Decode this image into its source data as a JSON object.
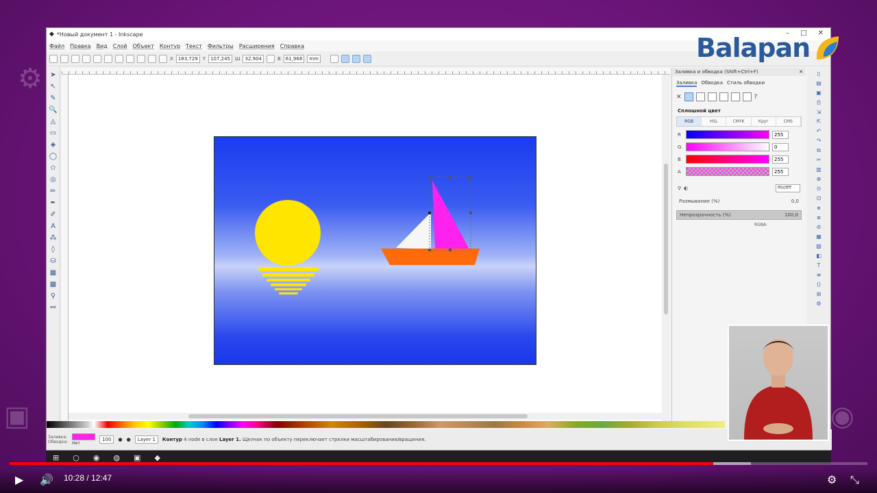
{
  "window": {
    "title": "*Новый документ 1 - Inkscape",
    "controls": [
      "–",
      "□",
      "✕"
    ]
  },
  "menu": [
    "Файл",
    "Правка",
    "Вид",
    "Слой",
    "Объект",
    "Контур",
    "Текст",
    "Фильтры",
    "Расширения",
    "Справка"
  ],
  "tool_controls": {
    "x_label": "X",
    "x_value": "183,729",
    "y_label": "Y",
    "y_value": "107,245",
    "w_label": "Ш",
    "w_value": "32,904",
    "h_label": "В",
    "h_value": "61,968",
    "unit": "mm"
  },
  "tools": [
    "pointer-icon",
    "node-icon",
    "tweak-icon",
    "zoom-icon",
    "measure-icon",
    "rect-icon",
    "3dbox-icon",
    "ellipse-icon",
    "star-icon",
    "spiral-icon",
    "pencil-icon",
    "pen-icon",
    "calligraphy-icon",
    "text-icon",
    "spray-icon",
    "eraser-icon",
    "bucket-icon",
    "gradient-icon",
    "mesh-icon",
    "dropper-icon",
    "connector-icon"
  ],
  "panel": {
    "title": "Заливка и обводка (Shift+Ctrl+F)",
    "tabs": [
      "Заливка",
      "Обводка",
      "Стиль обводки"
    ],
    "solid_label": "Сплошной цвет",
    "color_modes": [
      "RGB",
      "HSL",
      "CMYK",
      "Круг",
      "CMS"
    ],
    "sliders": [
      {
        "label": "R",
        "value": "255",
        "gradient": "linear-gradient(90deg,#0000ff,#ff00ff)"
      },
      {
        "label": "G",
        "value": "0",
        "gradient": "linear-gradient(90deg,#ff00ff,#ffffff)"
      },
      {
        "label": "B",
        "value": "255",
        "gradient": "linear-gradient(90deg,#ff0000,#ff00ff)"
      },
      {
        "label": "A",
        "value": "255",
        "gradient": "repeating-conic-gradient(#b0b0b0 0 25%, #ff44ee 0 50%) 0 0/6px 6px"
      }
    ],
    "rgba_label": "RGBA:",
    "rgba_value": "ff00ffff",
    "blur_label": "Размывание (%)",
    "blur_value": "0,0",
    "opacity_label": "Непрозрачность (%)",
    "opacity_value": "100,0"
  },
  "status": {
    "fill_label": "Заливка:",
    "stroke_label": "Обводка:",
    "stroke_value": "Нет",
    "opacity_value": "100",
    "layer": "Layer 1",
    "message_bold": "Контур",
    "message": "4 node в слое",
    "message_layer": "Layer 1.",
    "message_rest": "Щелчок по объекту переключает стрелки масштабирования/вращения."
  },
  "logo": {
    "text": "Balapan"
  },
  "player": {
    "current_time": "10:28",
    "separator": " / ",
    "duration": "12:47",
    "progress": 0.82
  },
  "colors": {
    "sun": "#ffe500",
    "sail_white": "#f6f6f6",
    "sail_magenta": "#ff22ee",
    "hull": "#ff6a0a",
    "accent_red": "#ff0000"
  }
}
